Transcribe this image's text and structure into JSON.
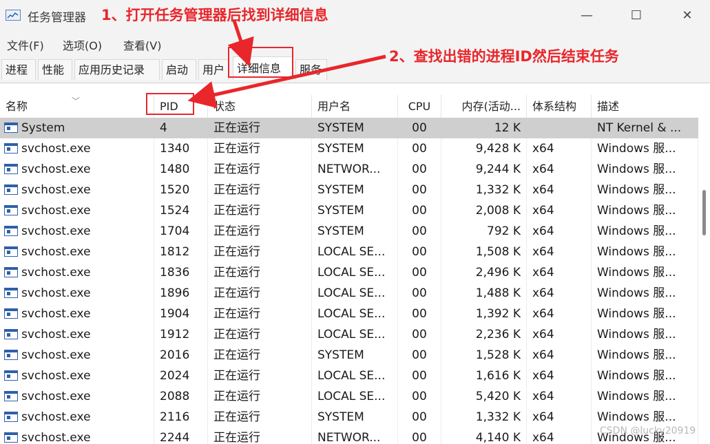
{
  "window": {
    "title": "任务管理器",
    "minimize": "—",
    "maximize": "☐",
    "close": "✕"
  },
  "menu": [
    "文件(F)",
    "选项(O)",
    "查看(V)"
  ],
  "tabs": [
    "进程",
    "性能",
    "应用历史记录",
    "启动",
    "用户",
    "详细信息",
    "服务"
  ],
  "active_tab": "详细信息",
  "columns": [
    "名称",
    "PID",
    "状态",
    "用户名",
    "CPU",
    "内存(活动...",
    "体系结构",
    "描述"
  ],
  "rows": [
    {
      "name": "System",
      "pid": "4",
      "status": "正在运行",
      "user": "SYSTEM",
      "cpu": "00",
      "mem": "12 K",
      "arch": "",
      "desc": "NT Kernel & ...",
      "selected": true
    },
    {
      "name": "svchost.exe",
      "pid": "1340",
      "status": "正在运行",
      "user": "SYSTEM",
      "cpu": "00",
      "mem": "9,428 K",
      "arch": "x64",
      "desc": "Windows 服..."
    },
    {
      "name": "svchost.exe",
      "pid": "1480",
      "status": "正在运行",
      "user": "NETWOR...",
      "cpu": "00",
      "mem": "9,244 K",
      "arch": "x64",
      "desc": "Windows 服..."
    },
    {
      "name": "svchost.exe",
      "pid": "1520",
      "status": "正在运行",
      "user": "SYSTEM",
      "cpu": "00",
      "mem": "1,332 K",
      "arch": "x64",
      "desc": "Windows 服..."
    },
    {
      "name": "svchost.exe",
      "pid": "1524",
      "status": "正在运行",
      "user": "SYSTEM",
      "cpu": "00",
      "mem": "2,008 K",
      "arch": "x64",
      "desc": "Windows 服..."
    },
    {
      "name": "svchost.exe",
      "pid": "1704",
      "status": "正在运行",
      "user": "SYSTEM",
      "cpu": "00",
      "mem": "792 K",
      "arch": "x64",
      "desc": "Windows 服..."
    },
    {
      "name": "svchost.exe",
      "pid": "1812",
      "status": "正在运行",
      "user": "LOCAL SE...",
      "cpu": "00",
      "mem": "1,508 K",
      "arch": "x64",
      "desc": "Windows 服..."
    },
    {
      "name": "svchost.exe",
      "pid": "1836",
      "status": "正在运行",
      "user": "LOCAL SE...",
      "cpu": "00",
      "mem": "2,496 K",
      "arch": "x64",
      "desc": "Windows 服..."
    },
    {
      "name": "svchost.exe",
      "pid": "1896",
      "status": "正在运行",
      "user": "LOCAL SE...",
      "cpu": "00",
      "mem": "1,488 K",
      "arch": "x64",
      "desc": "Windows 服..."
    },
    {
      "name": "svchost.exe",
      "pid": "1904",
      "status": "正在运行",
      "user": "LOCAL SE...",
      "cpu": "00",
      "mem": "1,392 K",
      "arch": "x64",
      "desc": "Windows 服..."
    },
    {
      "name": "svchost.exe",
      "pid": "1912",
      "status": "正在运行",
      "user": "LOCAL SE...",
      "cpu": "00",
      "mem": "2,236 K",
      "arch": "x64",
      "desc": "Windows 服..."
    },
    {
      "name": "svchost.exe",
      "pid": "2016",
      "status": "正在运行",
      "user": "SYSTEM",
      "cpu": "00",
      "mem": "1,528 K",
      "arch": "x64",
      "desc": "Windows 服..."
    },
    {
      "name": "svchost.exe",
      "pid": "2024",
      "status": "正在运行",
      "user": "LOCAL SE...",
      "cpu": "00",
      "mem": "1,616 K",
      "arch": "x64",
      "desc": "Windows 服..."
    },
    {
      "name": "svchost.exe",
      "pid": "2088",
      "status": "正在运行",
      "user": "LOCAL SE...",
      "cpu": "00",
      "mem": "5,420 K",
      "arch": "x64",
      "desc": "Windows 服..."
    },
    {
      "name": "svchost.exe",
      "pid": "2116",
      "status": "正在运行",
      "user": "SYSTEM",
      "cpu": "00",
      "mem": "1,332 K",
      "arch": "x64",
      "desc": "Windows 服..."
    },
    {
      "name": "svchost.exe",
      "pid": "2244",
      "status": "正在运行",
      "user": "NETWOR...",
      "cpu": "00",
      "mem": "4,140 K",
      "arch": "x64",
      "desc": "Windows 服..."
    }
  ],
  "annotations": {
    "step1": "1、打开任务管理器后找到详细信息",
    "step2": "2、查找出错的进程ID然后结束任务"
  },
  "watermark": "CSDN @lucky20919",
  "colors": {
    "annotation": "#e8262b",
    "selected_row": "#cfcfcf",
    "chrome": "#f3f3f3"
  },
  "icons": {
    "app": "task-manager-icon",
    "process": "process-window-icon"
  }
}
